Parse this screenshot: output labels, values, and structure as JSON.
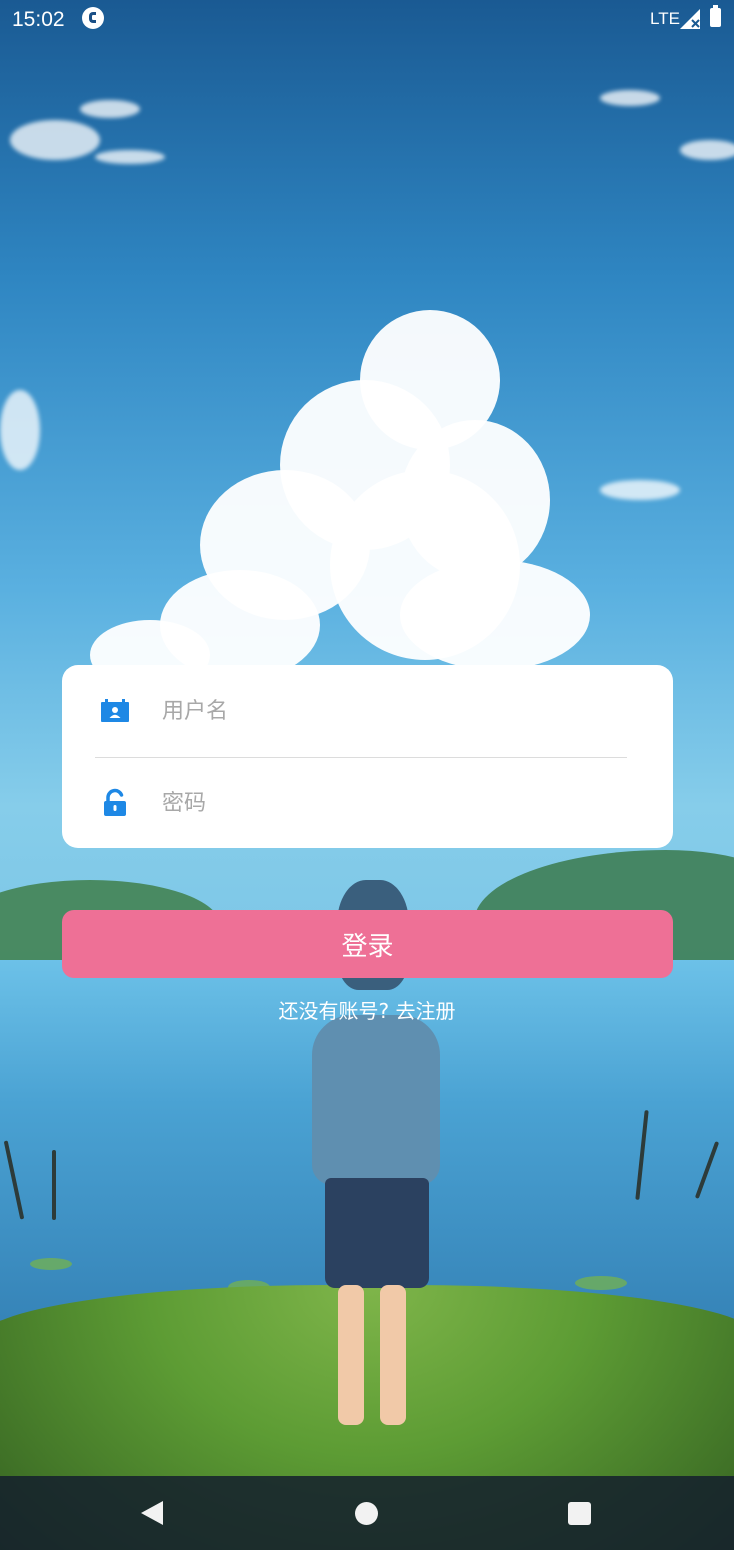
{
  "status_bar": {
    "time": "15:02",
    "network": "LTE",
    "icons": [
      "app-notification-icon",
      "signal-icon",
      "battery-icon"
    ]
  },
  "login_form": {
    "username": {
      "placeholder": "用户名",
      "value": "",
      "icon": "user-card-icon"
    },
    "password": {
      "placeholder": "密码",
      "value": "",
      "icon": "unlock-icon"
    },
    "login_button_label": "登录",
    "register_prompt": "还没有账号?",
    "register_action": "去注册"
  },
  "nav_bar": {
    "icons": [
      "back-icon",
      "home-icon",
      "recents-icon"
    ]
  },
  "colors": {
    "accent_pink": "#ee7096",
    "icon_blue": "#1e88e5",
    "card_background": "#ffffff"
  }
}
